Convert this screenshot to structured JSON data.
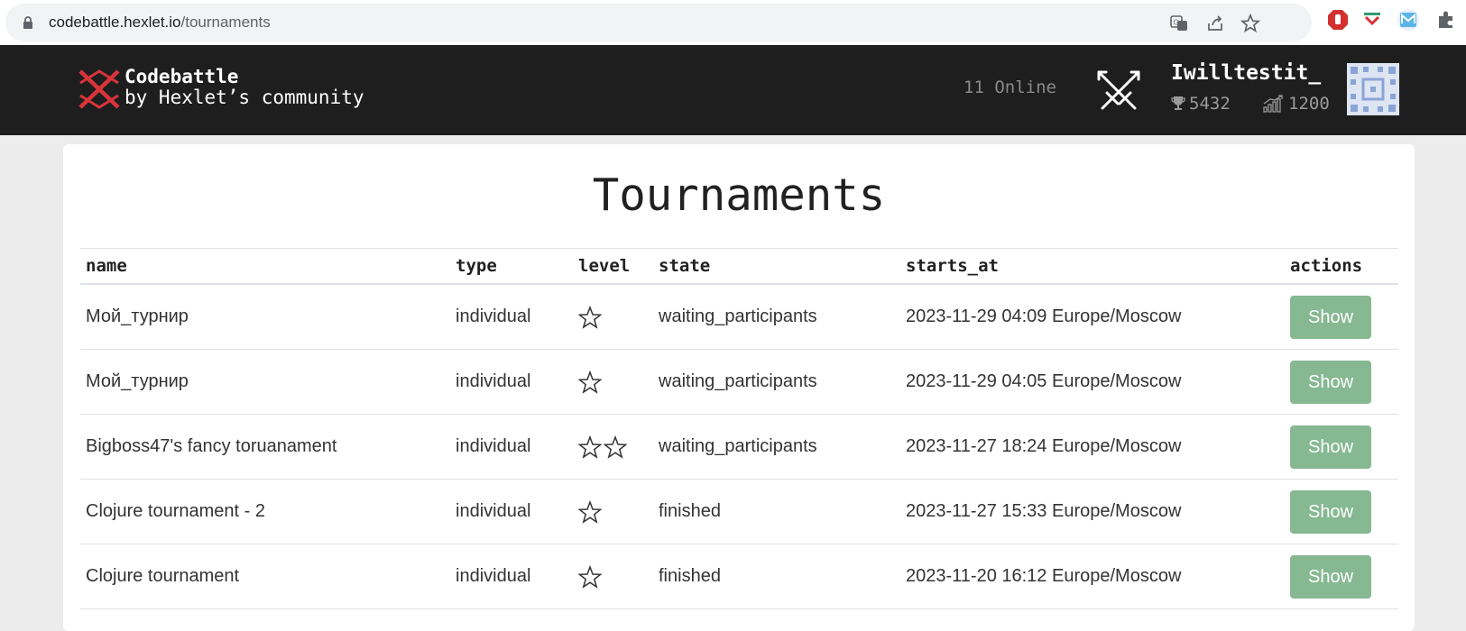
{
  "browser": {
    "url_host": "codebattle.hexlet.io",
    "url_path": "/tournaments"
  },
  "header": {
    "brand_title": "Codebattle",
    "brand_subtitle": "by Hexlet’s community",
    "online_count": "11 Online",
    "user": {
      "name": "Iwilltestit_",
      "rating": "5432",
      "rank": "1200"
    }
  },
  "page": {
    "title": "Tournaments"
  },
  "table": {
    "headers": [
      "name",
      "type",
      "level",
      "state",
      "starts_at",
      "actions"
    ],
    "rows": [
      {
        "name": "Мой_турнир",
        "type": "individual",
        "level_stars": 1,
        "state": "waiting_participants",
        "starts_at": "2023-11-29 04:09 Europe/Moscow",
        "action": "Show"
      },
      {
        "name": "Мой_турнир",
        "type": "individual",
        "level_stars": 1,
        "state": "waiting_participants",
        "starts_at": "2023-11-29 04:05 Europe/Moscow",
        "action": "Show"
      },
      {
        "name": "Bigboss47's fancy toruanament",
        "type": "individual",
        "level_stars": 2,
        "state": "waiting_participants",
        "starts_at": "2023-11-27 18:24 Europe/Moscow",
        "action": "Show"
      },
      {
        "name": "Clojure tournament - 2",
        "type": "individual",
        "level_stars": 1,
        "state": "finished",
        "starts_at": "2023-11-27 15:33 Europe/Moscow",
        "action": "Show"
      },
      {
        "name": "Clojure tournament",
        "type": "individual",
        "level_stars": 1,
        "state": "finished",
        "starts_at": "2023-11-20 16:12 Europe/Moscow",
        "action": "Show"
      }
    ]
  },
  "colors": {
    "header_bg": "#1e1e1e",
    "button_bg": "#86b892",
    "logo_red": "#d9343a"
  }
}
